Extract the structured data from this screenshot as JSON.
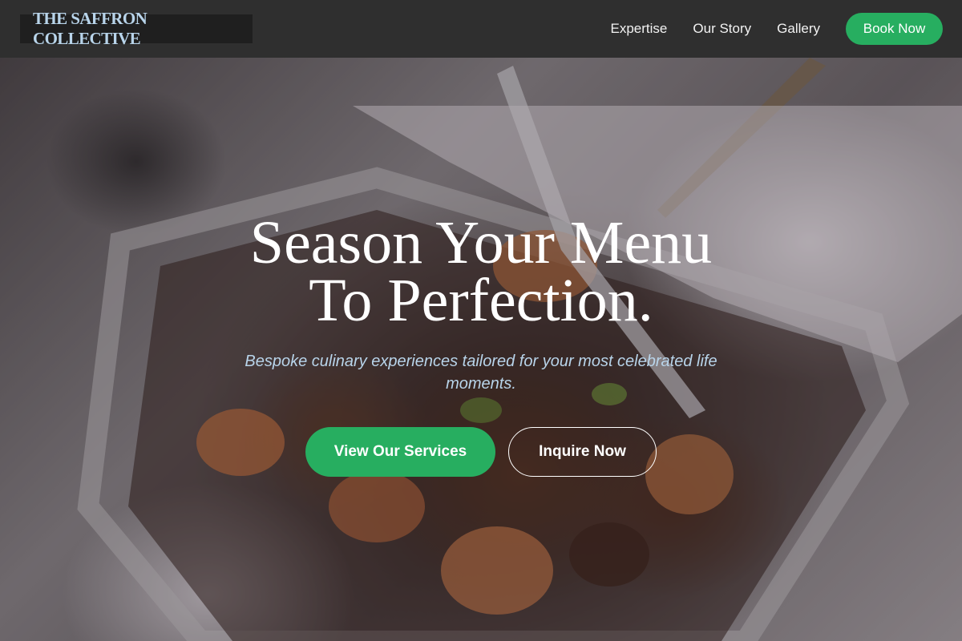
{
  "header": {
    "logo_text": "THE SAFFRON COLLECTIVE",
    "nav": [
      {
        "label": "Expertise"
      },
      {
        "label": "Our Story"
      },
      {
        "label": "Gallery"
      }
    ],
    "cta_label": "Book Now"
  },
  "hero": {
    "headline_line1": "Season Your Menu",
    "headline_line2": "To Perfection.",
    "subtitle": "Bespoke culinary experiences tailored for your most celebrated life moments.",
    "primary_button": "View Our Services",
    "secondary_button": "Inquire Now"
  },
  "colors": {
    "accent": "#27ae60",
    "header_bg": "#2f2f2f",
    "logo_text": "#b8d4ea",
    "subtitle": "#b8d4ea"
  }
}
